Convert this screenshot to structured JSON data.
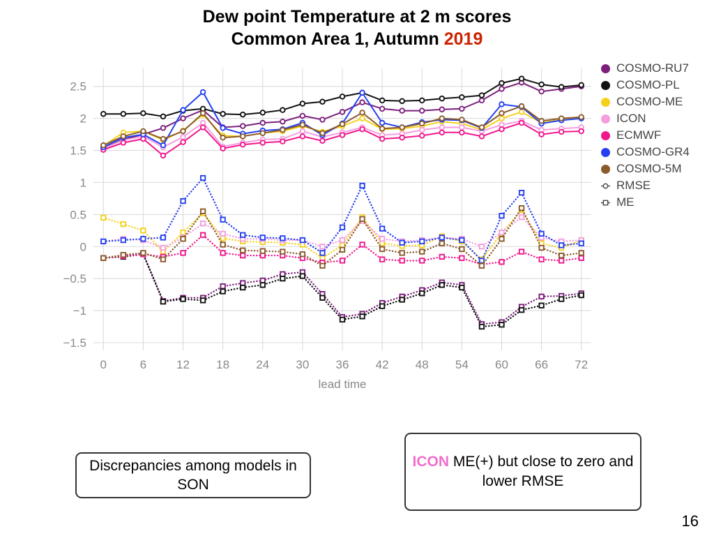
{
  "title": {
    "line1": "Dew point Temperature at 2 m scores",
    "line2_prefix": "Common Area 1, Autumn ",
    "year": "2019",
    "year_color": "#cc2200"
  },
  "legend": {
    "models": [
      {
        "label": "COSMO-RU7",
        "color": "#7b1f7b"
      },
      {
        "label": "COSMO-PL",
        "color": "#111111"
      },
      {
        "label": "COSMO-ME",
        "color": "#f5d11e"
      },
      {
        "label": "ICON",
        "color": "#f49ede"
      },
      {
        "label": "ECMWF",
        "color": "#f0168c"
      },
      {
        "label": "COSMO-GR4",
        "color": "#2440f0"
      },
      {
        "label": "COSMO-5M",
        "color": "#8a5a2b"
      }
    ],
    "scores": [
      {
        "label": "RMSE",
        "marker": "circle"
      },
      {
        "label": "ME",
        "marker": "square"
      }
    ]
  },
  "annotations": {
    "left_box": "Discrepancies among models in SON",
    "right_box_prefix": "ICON",
    "right_box_text": " ME(+) but close to zero and lower RMSE"
  },
  "page_number": "16",
  "chart_data": {
    "type": "line",
    "title": "Dew point Temperature at 2 m scores — Common Area 1, Autumn 2019",
    "xlabel": "lead time",
    "ylabel": "",
    "xticks": [
      0,
      6,
      12,
      18,
      24,
      30,
      36,
      42,
      48,
      54,
      60,
      66,
      72
    ],
    "yticks": [
      -1.5,
      -1,
      -0.5,
      0,
      0.5,
      1,
      1.5,
      2,
      2.5
    ],
    "xlim": [
      -1.5,
      73.5
    ],
    "ylim": [
      -1.62,
      2.78
    ],
    "grid": true,
    "legend_position": "right",
    "x": [
      0,
      3,
      6,
      9,
      12,
      15,
      18,
      21,
      24,
      27,
      30,
      33,
      36,
      39,
      42,
      45,
      48,
      51,
      54,
      57,
      60,
      63,
      66,
      69,
      72
    ],
    "series": [
      {
        "name": "COSMO-RU7 RMSE",
        "color": "#7b1f7b",
        "style": "solid",
        "marker": "circle",
        "values": [
          1.53,
          1.67,
          1.75,
          1.85,
          2.0,
          2.13,
          1.86,
          1.88,
          1.93,
          1.95,
          2.04,
          1.98,
          2.1,
          2.25,
          2.15,
          2.12,
          2.12,
          2.14,
          2.15,
          2.28,
          2.46,
          2.56,
          2.42,
          2.46,
          2.5
        ]
      },
      {
        "name": "COSMO-PL RMSE",
        "color": "#111111",
        "style": "solid",
        "marker": "circle",
        "values": [
          2.07,
          2.07,
          2.08,
          2.03,
          2.12,
          2.15,
          2.07,
          2.06,
          2.09,
          2.13,
          2.23,
          2.26,
          2.34,
          2.4,
          2.28,
          2.27,
          2.28,
          2.31,
          2.33,
          2.36,
          2.55,
          2.62,
          2.53,
          2.49,
          2.52
        ]
      },
      {
        "name": "COSMO-ME RMSE",
        "color": "#f5d11e",
        "style": "solid",
        "marker": "circle",
        "values": [
          1.57,
          1.78,
          1.8,
          1.66,
          1.81,
          2.06,
          1.73,
          1.72,
          1.77,
          1.8,
          1.88,
          1.79,
          1.88,
          2.0,
          1.83,
          1.84,
          1.88,
          1.95,
          1.92,
          1.82,
          2.0,
          2.1,
          1.93,
          1.98,
          2.0
        ]
      },
      {
        "name": "ICON RMSE",
        "color": "#f49ede",
        "style": "solid",
        "marker": "circle",
        "values": [
          1.53,
          1.66,
          1.72,
          1.55,
          1.71,
          1.93,
          1.56,
          1.62,
          1.67,
          1.68,
          1.8,
          1.71,
          1.78,
          1.86,
          1.74,
          1.76,
          1.82,
          1.86,
          1.86,
          1.8,
          1.9,
          1.96,
          1.82,
          1.84,
          1.86
        ]
      },
      {
        "name": "ECMWF RMSE",
        "color": "#f0168c",
        "style": "solid",
        "marker": "circle",
        "values": [
          1.51,
          1.62,
          1.68,
          1.42,
          1.63,
          1.86,
          1.53,
          1.59,
          1.62,
          1.64,
          1.72,
          1.65,
          1.74,
          1.83,
          1.68,
          1.7,
          1.73,
          1.78,
          1.78,
          1.72,
          1.83,
          1.93,
          1.75,
          1.79,
          1.8
        ]
      },
      {
        "name": "COSMO-GR4 RMSE",
        "color": "#2440f0",
        "style": "solid",
        "marker": "circle",
        "values": [
          1.55,
          1.7,
          1.75,
          1.58,
          2.13,
          2.41,
          1.85,
          1.76,
          1.81,
          1.83,
          1.93,
          1.74,
          1.92,
          2.4,
          1.93,
          1.86,
          1.94,
          1.98,
          1.97,
          1.85,
          2.22,
          2.18,
          1.92,
          1.97,
          2.0
        ]
      },
      {
        "name": "COSMO-5M RMSE",
        "color": "#8a5a2b",
        "style": "solid",
        "marker": "circle",
        "values": [
          1.58,
          1.72,
          1.8,
          1.68,
          1.8,
          2.08,
          1.7,
          1.72,
          1.77,
          1.82,
          1.9,
          1.77,
          1.91,
          2.09,
          1.84,
          1.86,
          1.92,
          2.0,
          1.98,
          1.86,
          2.08,
          2.19,
          1.96,
          2.0,
          2.02
        ]
      },
      {
        "name": "COSMO-RU7 ME",
        "color": "#7b1f7b",
        "style": "dotted",
        "marker": "square",
        "values": [
          -0.18,
          -0.14,
          -0.11,
          -0.85,
          -0.8,
          -0.8,
          -0.62,
          -0.57,
          -0.53,
          -0.43,
          -0.4,
          -0.74,
          -1.1,
          -1.05,
          -0.88,
          -0.78,
          -0.68,
          -0.56,
          -0.6,
          -1.21,
          -1.18,
          -0.94,
          -0.78,
          -0.77,
          -0.73
        ]
      },
      {
        "name": "COSMO-PL ME",
        "color": "#111111",
        "style": "dotted",
        "marker": "square",
        "values": [
          -0.18,
          -0.16,
          -0.12,
          -0.86,
          -0.82,
          -0.84,
          -0.7,
          -0.64,
          -0.6,
          -0.5,
          -0.46,
          -0.8,
          -1.14,
          -1.09,
          -0.93,
          -0.83,
          -0.73,
          -0.6,
          -0.64,
          -1.25,
          -1.22,
          -0.99,
          -0.92,
          -0.82,
          -0.76
        ]
      },
      {
        "name": "COSMO-ME ME",
        "color": "#f5d11e",
        "style": "dotted",
        "marker": "square",
        "values": [
          0.45,
          0.35,
          0.25,
          -0.08,
          0.22,
          0.52,
          0.13,
          0.08,
          0.07,
          0.06,
          0.03,
          -0.18,
          0.02,
          0.46,
          0.05,
          0.01,
          0.02,
          0.16,
          0.08,
          -0.2,
          0.21,
          0.57,
          0.05,
          -0.02,
          0.1
        ]
      },
      {
        "name": "ICON ME",
        "color": "#f49ede",
        "style": "dotted",
        "marker": "square",
        "values": [
          0.08,
          0.12,
          0.1,
          -0.02,
          0.14,
          0.36,
          0.2,
          0.12,
          0.12,
          0.1,
          0.1,
          0.0,
          0.1,
          0.4,
          0.12,
          0.08,
          0.1,
          0.14,
          0.12,
          0.0,
          0.22,
          0.46,
          0.14,
          0.08,
          0.1
        ]
      },
      {
        "name": "ECMWF ME",
        "color": "#f0168c",
        "style": "dotted",
        "marker": "square",
        "values": [
          -0.18,
          -0.15,
          -0.12,
          -0.16,
          -0.1,
          0.18,
          -0.1,
          -0.14,
          -0.14,
          -0.14,
          -0.18,
          -0.25,
          -0.22,
          0.03,
          -0.2,
          -0.22,
          -0.22,
          -0.16,
          -0.18,
          -0.28,
          -0.24,
          -0.08,
          -0.2,
          -0.22,
          -0.18
        ]
      },
      {
        "name": "COSMO-GR4 ME",
        "color": "#2440f0",
        "style": "dotted",
        "marker": "square",
        "values": [
          0.08,
          0.1,
          0.12,
          0.14,
          0.71,
          1.07,
          0.42,
          0.18,
          0.14,
          0.13,
          0.1,
          -0.1,
          0.3,
          0.95,
          0.28,
          0.06,
          0.08,
          0.14,
          0.1,
          -0.22,
          0.48,
          0.84,
          0.2,
          0.02,
          0.05
        ]
      },
      {
        "name": "COSMO-5M ME",
        "color": "#8a5a2b",
        "style": "dotted",
        "marker": "square",
        "values": [
          -0.18,
          -0.13,
          -0.1,
          -0.2,
          0.12,
          0.55,
          0.03,
          -0.06,
          -0.07,
          -0.08,
          -0.12,
          -0.3,
          -0.05,
          0.43,
          -0.04,
          -0.1,
          -0.08,
          0.05,
          -0.04,
          -0.3,
          0.12,
          0.6,
          -0.02,
          -0.14,
          -0.1
        ]
      }
    ]
  }
}
